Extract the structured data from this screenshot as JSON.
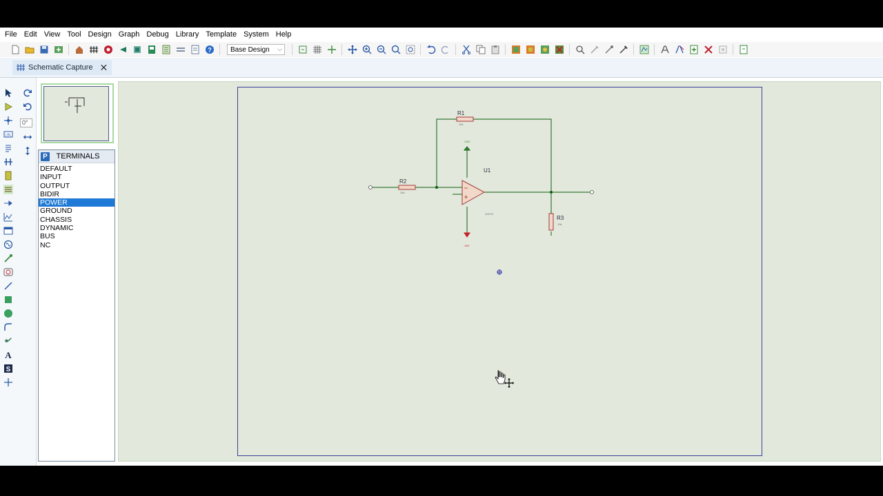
{
  "menu": [
    "File",
    "Edit",
    "View",
    "Tool",
    "Design",
    "Graph",
    "Debug",
    "Library",
    "Template",
    "System",
    "Help"
  ],
  "toolbar": {
    "design_variant": "Base Design",
    "buttons": [
      {
        "name": "new-icon",
        "color": "#ffffff"
      },
      {
        "name": "open-icon",
        "color": "#e8b830"
      },
      {
        "name": "save-icon",
        "color": "#3a6ab0"
      },
      {
        "name": "import-icon",
        "color": "#4a9a4a"
      },
      {
        "name": "home-icon",
        "color": "#a05030"
      },
      {
        "name": "schematic-icon",
        "color": "#333"
      },
      {
        "name": "pcb-icon",
        "color": "#1a7a5a"
      },
      {
        "name": "gerber-icon",
        "color": "#c02030"
      },
      {
        "name": "3d-icon",
        "color": "#3aa0a0"
      },
      {
        "name": "bom-icon",
        "color": "#5a8a3a"
      },
      {
        "name": "netlist-icon",
        "color": "#3a6a6a"
      },
      {
        "name": "code-icon",
        "color": "#5a6a8a"
      },
      {
        "name": "notes-icon",
        "color": "#7a7a9a"
      },
      {
        "name": "help-icon",
        "color": "#2a6ac8"
      }
    ]
  },
  "tab": {
    "label": "Schematic Capture",
    "close": "✕"
  },
  "rotation_value": "0°",
  "terminals": {
    "badge": "P",
    "title": "TERMINALS",
    "items": [
      "DEFAULT",
      "INPUT",
      "OUTPUT",
      "BIDIR",
      "POWER",
      "GROUND",
      "CHASSIS",
      "DYNAMIC",
      "BUS",
      "NC"
    ],
    "selected": "POWER"
  },
  "schematic": {
    "components": [
      {
        "ref": "R1",
        "value": "10k"
      },
      {
        "ref": "R2",
        "value": "10k"
      },
      {
        "ref": "R3",
        "value": "10k"
      },
      {
        "ref": "U1",
        "value": "LM741"
      }
    ],
    "power_top": "+15V",
    "power_bottom": "-15V",
    "wire_color": "#0f5f0f",
    "component_color": "#a33a3a",
    "sheet_border_color": "#3b3f99"
  }
}
